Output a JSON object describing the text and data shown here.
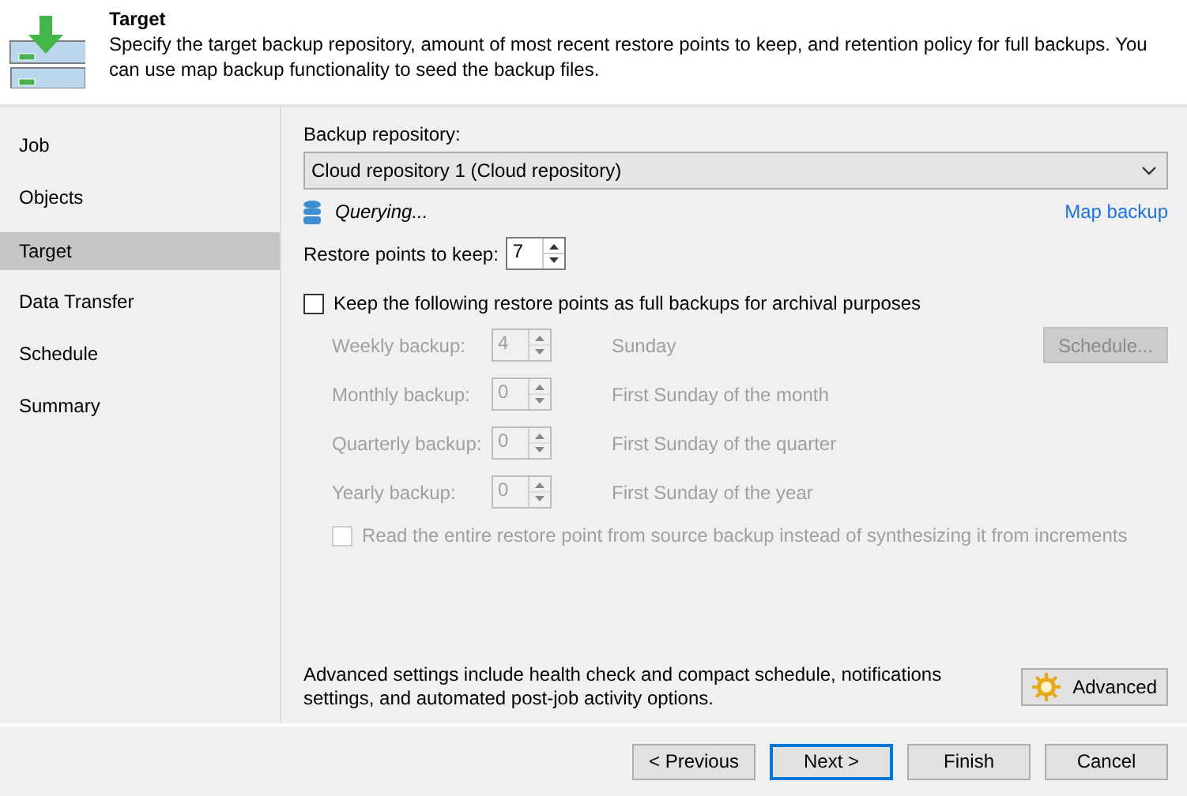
{
  "header": {
    "title": "Target",
    "description": "Specify the target backup repository, amount of most recent restore points to keep, and retention policy for full backups. You can use map backup functionality to seed the backup files."
  },
  "sidebar": {
    "items": [
      {
        "label": "Job",
        "selected": false
      },
      {
        "label": "Objects",
        "selected": false
      },
      {
        "label": "Target",
        "selected": true
      },
      {
        "label": "Data Transfer",
        "selected": false
      },
      {
        "label": "Schedule",
        "selected": false
      },
      {
        "label": "Summary",
        "selected": false
      }
    ]
  },
  "repository": {
    "label": "Backup repository:",
    "value": "Cloud repository 1 (Cloud repository)",
    "status": "Querying...",
    "map_link": "Map backup"
  },
  "restore_points": {
    "label": "Restore points to keep:",
    "value": "7"
  },
  "archival": {
    "label": "Keep the following restore points as full backups for archival purposes",
    "checked": false,
    "disabled": false
  },
  "retention_rows": [
    {
      "label": "Weekly backup:",
      "value": "4",
      "description": "Sunday",
      "button": "Schedule...",
      "disabled": true
    },
    {
      "label": "Monthly backup:",
      "value": "0",
      "description": "First Sunday of the month",
      "disabled": true
    },
    {
      "label": "Quarterly backup:",
      "value": "0",
      "description": "First Sunday of the quarter",
      "disabled": true
    },
    {
      "label": "Yearly backup:",
      "value": "0",
      "description": "First Sunday of the year",
      "disabled": true
    }
  ],
  "read_entire": {
    "label": "Read the entire restore point from source backup instead of synthesizing it from increments",
    "checked": false,
    "disabled": true
  },
  "advanced": {
    "description": "Advanced settings include health check and compact schedule, notifications settings, and automated post-job activity options.",
    "button": "Advanced"
  },
  "buttons": [
    {
      "label": "< Previous",
      "selected": false
    },
    {
      "label": "Next >",
      "selected": true
    },
    {
      "label": "Finish",
      "selected": false
    },
    {
      "label": "Cancel",
      "selected": false
    }
  ]
}
